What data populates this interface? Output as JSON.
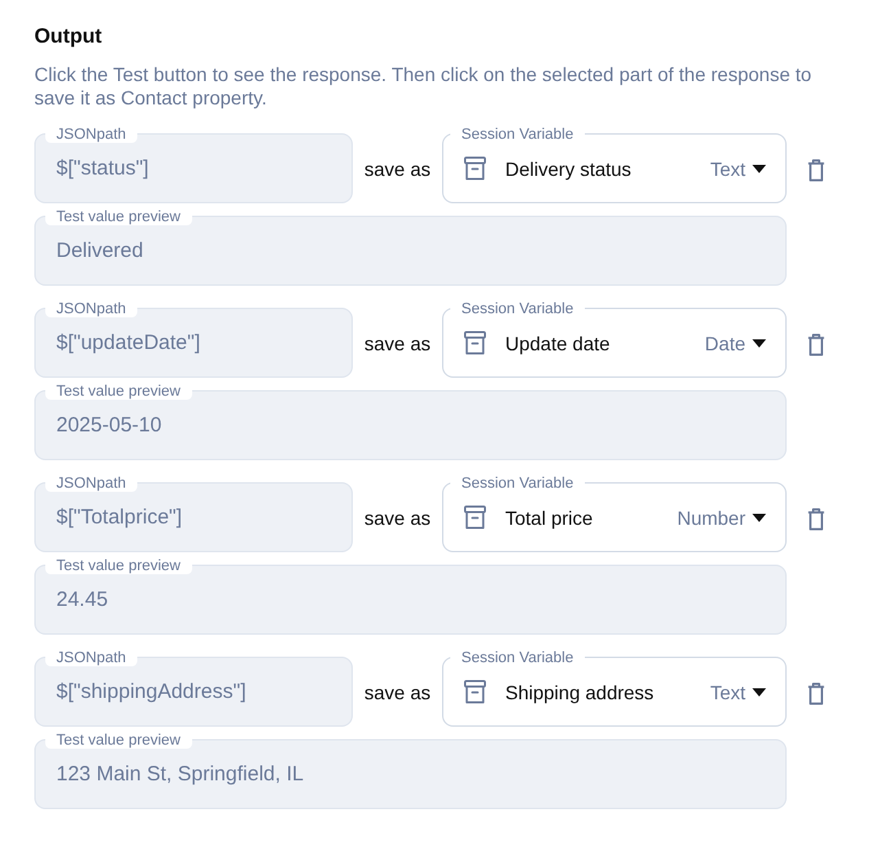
{
  "section": {
    "title": "Output",
    "description": "Click the Test button to see the response. Then click on the selected part of the response to save it as Contact property."
  },
  "mappings": [
    {
      "jsonpath": {
        "label": "JSONpath",
        "value": "$[\"status\"]"
      },
      "save_as": "save as",
      "session_variable": {
        "label": "Session Variable",
        "value": "Delivery status",
        "type": "Text"
      },
      "preview": {
        "label": "Test value preview",
        "value": "Delivered"
      }
    },
    {
      "jsonpath": {
        "label": "JSONpath",
        "value": "$[\"updateDate\"]"
      },
      "save_as": "save as",
      "session_variable": {
        "label": "Session Variable",
        "value": "Update date",
        "type": "Date"
      },
      "preview": {
        "label": "Test value preview",
        "value": "2025-05-10"
      }
    },
    {
      "jsonpath": {
        "label": "JSONpath",
        "value": "$[\"Totalprice\"]"
      },
      "save_as": "save as",
      "session_variable": {
        "label": "Session Variable",
        "value": "Total price",
        "type": "Number"
      },
      "preview": {
        "label": "Test value preview",
        "value": "24.45"
      }
    },
    {
      "jsonpath": {
        "label": "JSONpath",
        "value": "$[\"shippingAddress\"]"
      },
      "save_as": "save as",
      "session_variable": {
        "label": "Session Variable",
        "value": "Shipping address",
        "type": "Text"
      },
      "preview": {
        "label": "Test value preview",
        "value": "123 Main St, Springfield, IL"
      }
    }
  ]
}
